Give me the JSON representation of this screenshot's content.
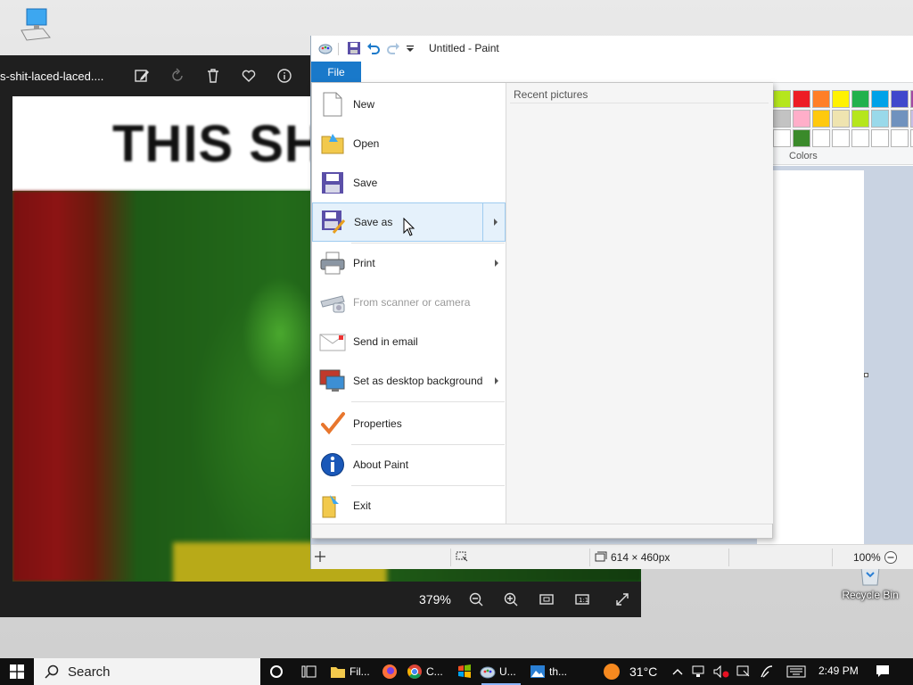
{
  "desktop": {
    "recycle_bin_label": "Recycle Bin",
    "pc_icon": "this-pc-icon"
  },
  "photos": {
    "filename": "s-shit-laced-laced....",
    "caption_text": "THIS SHIT",
    "zoom": "379%",
    "tools": [
      "edit-icon",
      "rotate-icon",
      "delete-icon",
      "favorite-icon",
      "info-icon"
    ],
    "bottom_tools": [
      "zoom-out-icon",
      "zoom-in-icon",
      "fit-icon",
      "actual-size-icon",
      "fullscreen-icon"
    ]
  },
  "paint": {
    "title": "Untitled - Paint",
    "file_tab": "File",
    "colors_label": "Colors",
    "palette": [
      "#b5e61d",
      "#ed1c24",
      "#ff7f27",
      "#fff200",
      "#22b14c",
      "#00a2e8",
      "#3f48cc",
      "#a349a4",
      "#c3c3c3",
      "#ffaec9",
      "#ffc90e",
      "#efe4b0",
      "#b5e61d",
      "#99d9ea",
      "#7092be",
      "#c8bfe7",
      "#ffffff",
      "#3a8a2a",
      "#ffffff",
      "#ffffff",
      "#ffffff",
      "#ffffff",
      "#ffffff",
      "#ffffff"
    ],
    "status": {
      "dimensions": "614 × 460px",
      "zoom": "100%"
    }
  },
  "file_menu": {
    "recent_title": "Recent pictures",
    "items": [
      {
        "label": "New",
        "icon": "new-file-icon",
        "arrow": false,
        "disabled": false
      },
      {
        "label": "Open",
        "icon": "open-folder-icon",
        "arrow": false,
        "disabled": false
      },
      {
        "label": "Save",
        "icon": "save-disk-icon",
        "arrow": false,
        "disabled": false
      },
      {
        "label": "Save as",
        "icon": "save-as-icon",
        "arrow": true,
        "disabled": false,
        "hover": true
      },
      {
        "label": "Print",
        "icon": "printer-icon",
        "arrow": true,
        "disabled": false
      },
      {
        "label": "From scanner or camera",
        "icon": "scanner-icon",
        "arrow": false,
        "disabled": true
      },
      {
        "label": "Send in email",
        "icon": "email-icon",
        "arrow": false,
        "disabled": false
      },
      {
        "label": "Set as desktop background",
        "icon": "desktop-background-icon",
        "arrow": true,
        "disabled": false
      },
      {
        "label": "Properties",
        "icon": "properties-check-icon",
        "arrow": false,
        "disabled": false
      },
      {
        "label": "About Paint",
        "icon": "info-icon",
        "arrow": false,
        "disabled": false
      },
      {
        "label": "Exit",
        "icon": "exit-icon",
        "arrow": false,
        "disabled": false
      }
    ]
  },
  "taskbar": {
    "search_text": "Search",
    "apps": [
      {
        "label": "Fil...",
        "icon": "file-explorer-icon"
      },
      {
        "label": "",
        "icon": "firefox-icon"
      },
      {
        "label": "C...",
        "icon": "chrome-icon"
      },
      {
        "label": "",
        "icon": "windows-store-icon"
      },
      {
        "label": "U...",
        "icon": "paint-icon",
        "active": true
      },
      {
        "label": "th...",
        "icon": "photos-icon"
      }
    ],
    "weather_temp": "31°C",
    "clock": "2:49 PM"
  }
}
